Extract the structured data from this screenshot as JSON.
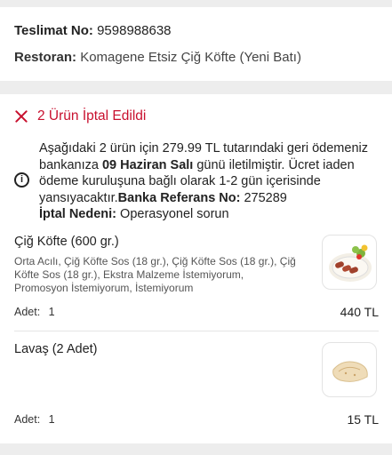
{
  "delivery": {
    "label": "Teslimat No:",
    "value": "9598988638"
  },
  "restaurant": {
    "label": "Restoran:",
    "value": "Komagene Etsiz Çiğ Köfte (Yeni Batı)"
  },
  "cancellation": {
    "title": "2 Ürün İptal Edildi",
    "text_1": "Aşağıdaki 2 ürün için 279.99 TL tutarındaki geri ödemeniz bankanıza ",
    "date": "09 Haziran Salı",
    "text_2": " günü iletilmiştir. Ücret iaden ödeme kuruluşuna bağlı olarak 1-2 gün içerisinde yansıyacaktır.",
    "ref_label": "Banka Referans No:",
    "ref_value": " 275289",
    "reason_label": "İptal Nedeni:",
    "reason_value": " Operasyonel sorun"
  },
  "items": [
    {
      "name": "Çiğ Köfte (600 gr.)",
      "description": "Orta Acılı, Çiğ Köfte Sos (18 gr.), Çiğ Köfte Sos (18 gr.), Çiğ Köfte Sos (18 gr.), Ekstra Malzeme İstemiyorum, Promosyon İstemiyorum, İstemiyorum",
      "qty_label": "Adet:",
      "qty": "1",
      "price": "440 TL",
      "thumb_icon": "cig-kofte-plate-icon"
    },
    {
      "name": "Lavaş (2 Adet)",
      "description": "",
      "qty_label": "Adet:",
      "qty": "1",
      "price": "15 TL",
      "thumb_icon": "lavash-bread-icon"
    }
  ],
  "colors": {
    "accent": "#c8102e",
    "background": "#ededed"
  }
}
